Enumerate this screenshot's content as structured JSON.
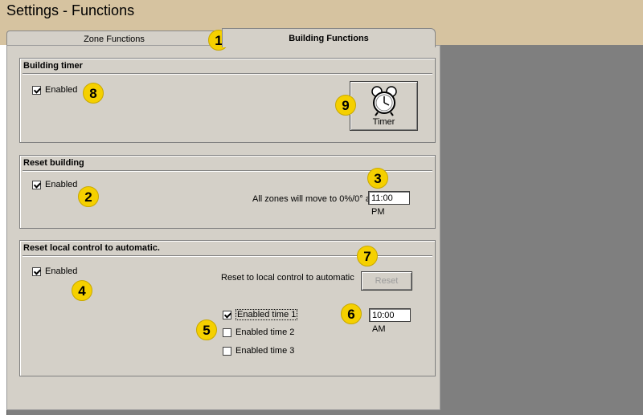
{
  "window": {
    "title": "Settings - Functions"
  },
  "tabs": [
    {
      "label": "Zone Functions",
      "active": false
    },
    {
      "label": "Building Functions",
      "active": true
    }
  ],
  "building_timer": {
    "title": "Building timer",
    "enabled_label": "Enabled",
    "enabled": true,
    "timer_button_label": "Timer",
    "timer_icon": "alarm-clock-icon"
  },
  "reset_building": {
    "title": "Reset building",
    "enabled_label": "Enabled",
    "enabled": true,
    "move_label": "All zones will move to 0%/0° at:",
    "time_value": "11:00 PM"
  },
  "reset_local": {
    "title": "Reset local control to automatic.",
    "enabled_label": "Enabled",
    "enabled": true,
    "reset_text": "Reset to local control to automatic",
    "reset_button_label": "Reset",
    "times": [
      {
        "label": "Enabled time 1",
        "checked": true
      },
      {
        "label": "Enabled time 2",
        "checked": false
      },
      {
        "label": "Enabled time 3",
        "checked": false
      }
    ],
    "time_value": "10:00 AM"
  },
  "callouts": [
    "1",
    "2",
    "3",
    "4",
    "5",
    "6",
    "7",
    "8",
    "9"
  ],
  "colors": {
    "callout": "#f5d000",
    "dialog": "#d4d0c8",
    "workspace": "#7f7f7f",
    "header": "#d6c3a0"
  }
}
